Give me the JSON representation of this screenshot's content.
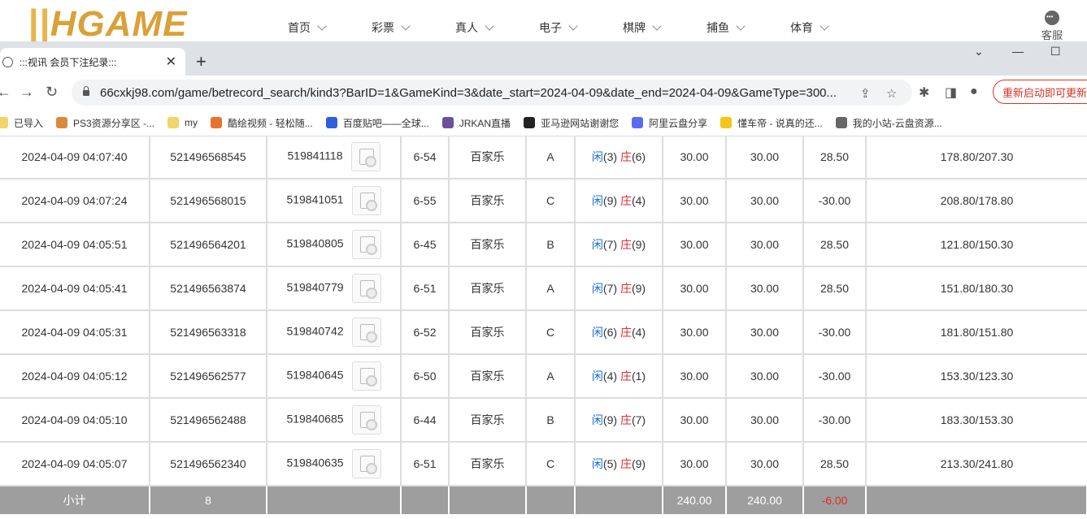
{
  "site": {
    "logo": "HGAME",
    "nav": [
      "首页",
      "彩票",
      "真人",
      "电子",
      "棋牌",
      "捕鱼",
      "体育"
    ],
    "support_label": "客服"
  },
  "browser": {
    "tab_title": ":::视讯 会员下注纪录:::",
    "url": "66cxkj98.com/game/betrecord_search/kind3?BarID=1&GameKind=3&date_start=2024-04-09&date_end=2024-04-09&GameType=300...",
    "restart_label": "重新启动即可更新",
    "bookmarks": [
      {
        "label": "已导入",
        "color": "#f3d36b"
      },
      {
        "label": "PS3资源分享区 -...",
        "color": "#d98b3a"
      },
      {
        "label": "my",
        "color": "#f3d36b"
      },
      {
        "label": "酷绘视频 - 轻松随...",
        "color": "#e8742c"
      },
      {
        "label": "百度贴吧——全球...",
        "color": "#2e5fe0"
      },
      {
        "label": "JRKAN直播",
        "color": "#6b4fa0"
      },
      {
        "label": "亚马逊网站谢谢您",
        "color": "#222222"
      },
      {
        "label": "阿里云盘分享",
        "color": "#5b6bf0"
      },
      {
        "label": "懂车帝 - 说真的还...",
        "color": "#f5c518"
      },
      {
        "label": "我的小站-云盘资源...",
        "color": "#666666"
      }
    ]
  },
  "records": [
    {
      "time": "2024-04-09 04:07:40",
      "bet_id": "521496568545",
      "round_id": "519841118",
      "table": "6-54",
      "game": "百家乐",
      "pick": "A",
      "player_label": "闲",
      "player": "3",
      "banker_label": "庄",
      "banker": "6",
      "amount": "30.00",
      "valid": "30.00",
      "result": "28.50",
      "balance": "178.80/207.30"
    },
    {
      "time": "2024-04-09 04:07:24",
      "bet_id": "521496568015",
      "round_id": "519841051",
      "table": "6-55",
      "game": "百家乐",
      "pick": "C",
      "player_label": "闲",
      "player": "9",
      "banker_label": "庄",
      "banker": "4",
      "amount": "30.00",
      "valid": "30.00",
      "result": "-30.00",
      "balance": "208.80/178.80"
    },
    {
      "time": "2024-04-09 04:05:51",
      "bet_id": "521496564201",
      "round_id": "519840805",
      "table": "6-45",
      "game": "百家乐",
      "pick": "B",
      "player_label": "闲",
      "player": "7",
      "banker_label": "庄",
      "banker": "9",
      "amount": "30.00",
      "valid": "30.00",
      "result": "28.50",
      "balance": "121.80/150.30"
    },
    {
      "time": "2024-04-09 04:05:41",
      "bet_id": "521496563874",
      "round_id": "519840779",
      "table": "6-51",
      "game": "百家乐",
      "pick": "A",
      "player_label": "闲",
      "player": "7",
      "banker_label": "庄",
      "banker": "9",
      "amount": "30.00",
      "valid": "30.00",
      "result": "28.50",
      "balance": "151.80/180.30"
    },
    {
      "time": "2024-04-09 04:05:31",
      "bet_id": "521496563318",
      "round_id": "519840742",
      "table": "6-52",
      "game": "百家乐",
      "pick": "C",
      "player_label": "闲",
      "player": "6",
      "banker_label": "庄",
      "banker": "4",
      "amount": "30.00",
      "valid": "30.00",
      "result": "-30.00",
      "balance": "181.80/151.80"
    },
    {
      "time": "2024-04-09 04:05:12",
      "bet_id": "521496562577",
      "round_id": "519840645",
      "table": "6-50",
      "game": "百家乐",
      "pick": "A",
      "player_label": "闲",
      "player": "4",
      "banker_label": "庄",
      "banker": "1",
      "amount": "30.00",
      "valid": "30.00",
      "result": "-30.00",
      "balance": "153.30/123.30"
    },
    {
      "time": "2024-04-09 04:05:10",
      "bet_id": "521496562488",
      "round_id": "519840685",
      "table": "6-44",
      "game": "百家乐",
      "pick": "B",
      "player_label": "闲",
      "player": "9",
      "banker_label": "庄",
      "banker": "7",
      "amount": "30.00",
      "valid": "30.00",
      "result": "-30.00",
      "balance": "183.30/153.30"
    },
    {
      "time": "2024-04-09 04:05:07",
      "bet_id": "521496562340",
      "round_id": "519840635",
      "table": "6-51",
      "game": "百家乐",
      "pick": "C",
      "player_label": "闲",
      "player": "5",
      "banker_label": "庄",
      "banker": "9",
      "amount": "30.00",
      "valid": "30.00",
      "result": "28.50",
      "balance": "213.30/241.80"
    }
  ],
  "subtotal": {
    "label": "小计",
    "count": "8",
    "amount": "240.00",
    "valid": "240.00",
    "result": "-6.00"
  }
}
